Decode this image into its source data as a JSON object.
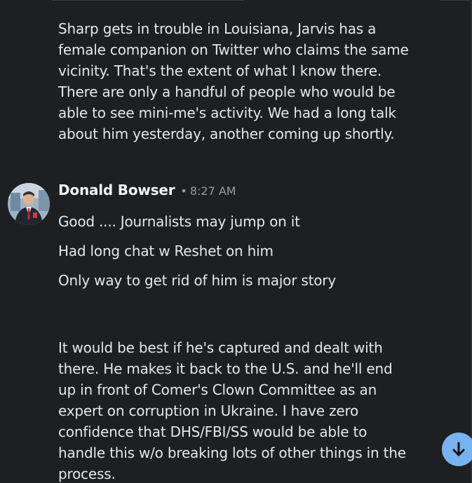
{
  "messages": {
    "prev_message_text": "Sharp gets in trouble in Louisiana, Jarvis has a female companion on Twitter who claims the same vicinity. That's the extent of what I know there. There are only a handful of people who would be able to see mini-me's activity. We had a long talk about him yesterday, another coming up shortly.",
    "author": {
      "name": "Donald Bowser",
      "separator": "•",
      "time": "8:27 AM"
    },
    "lines": [
      "Good .... Journalists may jump on it",
      "Had long chat w Reshet on him",
      "Only way to get rid of him is major story"
    ],
    "long_message_text": "It would be best if he's captured and dealt with there. He makes it back to the U.S. and he'll end up in front of Comer's Clown Committee as an expert on corruption in Ukraine. I have zero confidence that DHS/FBI/SS would be able to handle this w/o breaking lots of other things in the process."
  },
  "scroll_button": {
    "icon": "arrow-down-icon"
  },
  "colors": {
    "background": "#1e1f22",
    "text": "#e6e7ea",
    "muted": "#9a9ca3",
    "accent": "#78b3f0"
  }
}
